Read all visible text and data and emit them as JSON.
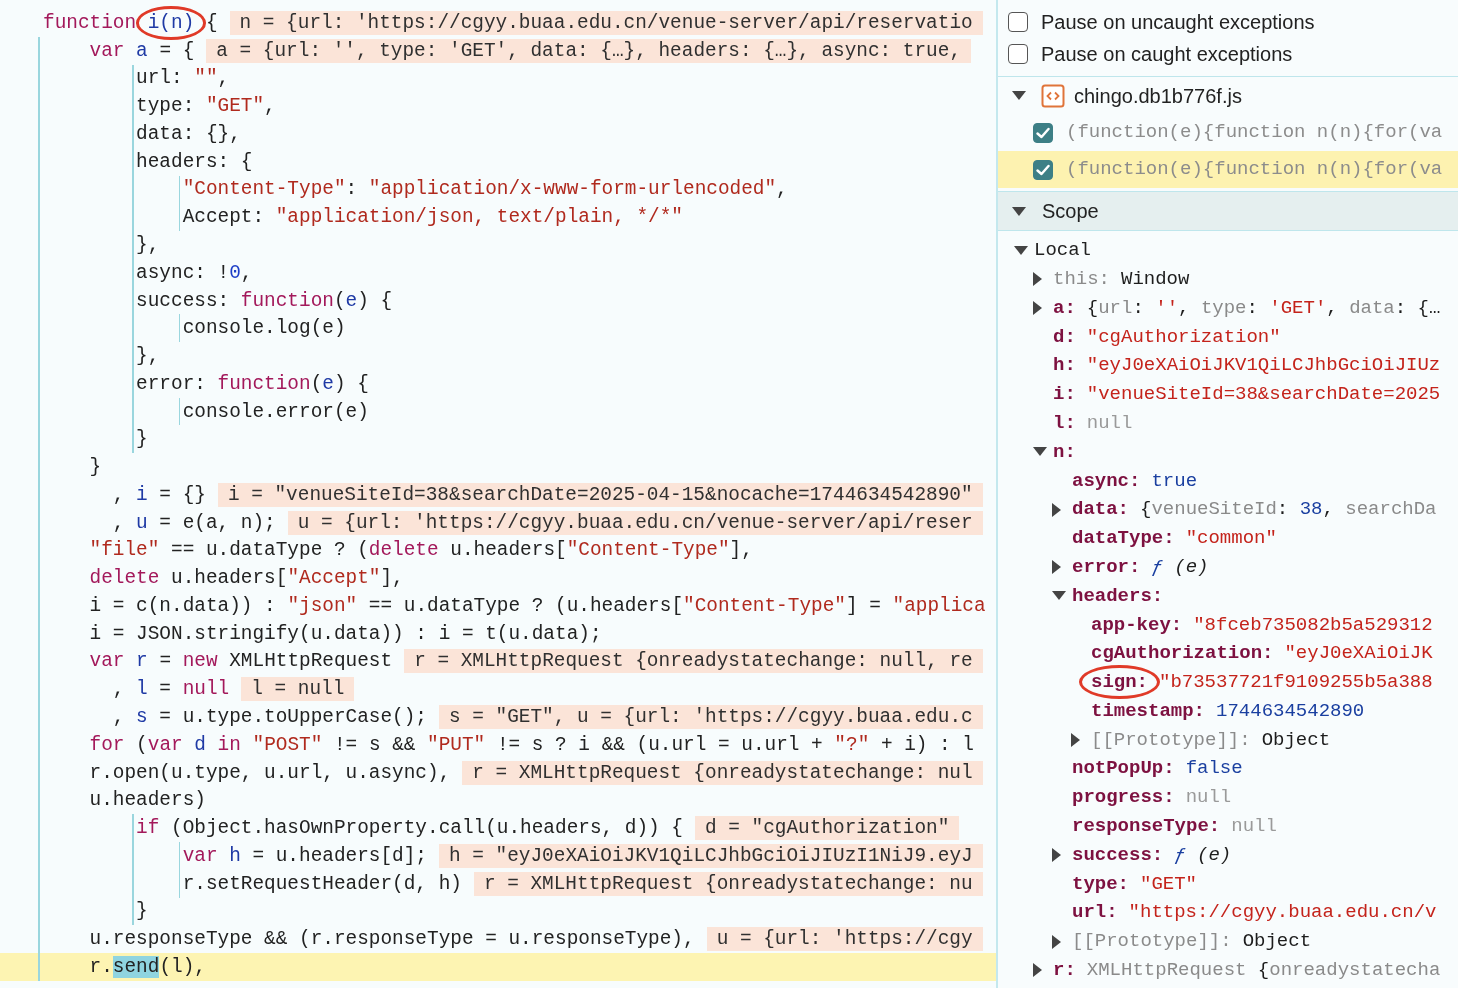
{
  "code_lines": [
    {
      "tokens": [
        {
          "kind": "kw",
          "text": "function "
        },
        {
          "kind": "circled",
          "text": "i(n)"
        },
        {
          "kind": "plain",
          "text": " {"
        }
      ],
      "inline_value": "n = {url: 'https://cgyy.buaa.edu.cn/venue-server/api/reservatio",
      "paused": false
    },
    {
      "tokens": [
        {
          "kind": "kw",
          "text": "    var"
        },
        {
          "kind": "def",
          "text": " a"
        },
        {
          "kind": "plain",
          "text": " = {"
        }
      ],
      "inline_value": "a = {url: '', type: 'GET', data: {…}, headers: {…}, async: true,",
      "paused": false
    },
    {
      "tokens": [
        {
          "kind": "plain",
          "text": "        url: "
        },
        {
          "kind": "str",
          "text": "\"\""
        },
        {
          "kind": "plain",
          "text": ","
        }
      ],
      "paused": false
    },
    {
      "tokens": [
        {
          "kind": "plain",
          "text": "        type: "
        },
        {
          "kind": "str",
          "text": "\"GET\""
        },
        {
          "kind": "plain",
          "text": ","
        }
      ],
      "paused": false
    },
    {
      "tokens": [
        {
          "kind": "plain",
          "text": "        data: {},"
        }
      ],
      "paused": false
    },
    {
      "tokens": [
        {
          "kind": "plain",
          "text": "        headers: {"
        }
      ],
      "paused": false
    },
    {
      "tokens": [
        {
          "kind": "str",
          "text": "            \"Content-Type\""
        },
        {
          "kind": "plain",
          "text": ": "
        },
        {
          "kind": "str",
          "text": "\"application/x-www-form-urlencoded\""
        },
        {
          "kind": "plain",
          "text": ","
        }
      ],
      "paused": false
    },
    {
      "tokens": [
        {
          "kind": "plain",
          "text": "            Accept: "
        },
        {
          "kind": "str",
          "text": "\"application/json, text/plain, */*\""
        }
      ],
      "paused": false
    },
    {
      "tokens": [
        {
          "kind": "plain",
          "text": "        },"
        }
      ],
      "paused": false
    },
    {
      "tokens": [
        {
          "kind": "plain",
          "text": "        async: !"
        },
        {
          "kind": "num",
          "text": "0"
        },
        {
          "kind": "plain",
          "text": ","
        }
      ],
      "paused": false
    },
    {
      "tokens": [
        {
          "kind": "plain",
          "text": "        success: "
        },
        {
          "kind": "kw",
          "text": "function"
        },
        {
          "kind": "plain",
          "text": "("
        },
        {
          "kind": "def",
          "text": "e"
        },
        {
          "kind": "plain",
          "text": ") {"
        }
      ],
      "paused": false
    },
    {
      "tokens": [
        {
          "kind": "plain",
          "text": "            console.log(e)"
        }
      ],
      "paused": false
    },
    {
      "tokens": [
        {
          "kind": "plain",
          "text": "        },"
        }
      ],
      "paused": false
    },
    {
      "tokens": [
        {
          "kind": "plain",
          "text": "        error: "
        },
        {
          "kind": "kw",
          "text": "function"
        },
        {
          "kind": "plain",
          "text": "("
        },
        {
          "kind": "def",
          "text": "e"
        },
        {
          "kind": "plain",
          "text": ") {"
        }
      ],
      "paused": false
    },
    {
      "tokens": [
        {
          "kind": "plain",
          "text": "            console.error(e)"
        }
      ],
      "paused": false
    },
    {
      "tokens": [
        {
          "kind": "plain",
          "text": "        }"
        }
      ],
      "paused": false
    },
    {
      "tokens": [
        {
          "kind": "plain",
          "text": "    }"
        }
      ],
      "paused": false
    },
    {
      "tokens": [
        {
          "kind": "plain",
          "text": "      , "
        },
        {
          "kind": "def",
          "text": "i"
        },
        {
          "kind": "plain",
          "text": " = {}"
        }
      ],
      "inline_value": "i = \"venueSiteId=38&searchDate=2025-04-15&nocache=1744634542890\"",
      "paused": false
    },
    {
      "tokens": [
        {
          "kind": "plain",
          "text": "      , "
        },
        {
          "kind": "def",
          "text": "u"
        },
        {
          "kind": "plain",
          "text": " = e(a, n);"
        }
      ],
      "inline_value": "u = {url: 'https://cgyy.buaa.edu.cn/venue-server/api/reser",
      "paused": false
    },
    {
      "tokens": [
        {
          "kind": "str",
          "text": "    \"file\""
        },
        {
          "kind": "plain",
          "text": " == u.dataType ? ("
        },
        {
          "kind": "kw",
          "text": "delete"
        },
        {
          "kind": "plain",
          "text": " u.headers["
        },
        {
          "kind": "str",
          "text": "\"Content-Type\""
        },
        {
          "kind": "plain",
          "text": "],"
        }
      ],
      "paused": false
    },
    {
      "tokens": [
        {
          "kind": "kw",
          "text": "    delete"
        },
        {
          "kind": "plain",
          "text": " u.headers["
        },
        {
          "kind": "str",
          "text": "\"Accept\""
        },
        {
          "kind": "plain",
          "text": "],"
        }
      ],
      "paused": false
    },
    {
      "tokens": [
        {
          "kind": "plain",
          "text": "    i = c(n.data)) : "
        },
        {
          "kind": "str",
          "text": "\"json\""
        },
        {
          "kind": "plain",
          "text": " == u.dataType ? (u.headers["
        },
        {
          "kind": "str",
          "text": "\"Content-Type\""
        },
        {
          "kind": "plain",
          "text": "] = "
        },
        {
          "kind": "str",
          "text": "\"applica"
        }
      ],
      "paused": false
    },
    {
      "tokens": [
        {
          "kind": "plain",
          "text": "    i = JSON.stringify(u.data)) : i = t(u.data);"
        }
      ],
      "paused": false
    },
    {
      "tokens": [
        {
          "kind": "kw",
          "text": "    var"
        },
        {
          "kind": "def",
          "text": " r"
        },
        {
          "kind": "plain",
          "text": " = "
        },
        {
          "kind": "kw",
          "text": "new"
        },
        {
          "kind": "plain",
          "text": " XMLHttpRequest"
        }
      ],
      "inline_value": "r = XMLHttpRequest {onreadystatechange: null, re",
      "paused": false
    },
    {
      "tokens": [
        {
          "kind": "plain",
          "text": "      , "
        },
        {
          "kind": "def",
          "text": "l"
        },
        {
          "kind": "plain",
          "text": " = "
        },
        {
          "kind": "kw",
          "text": "null"
        }
      ],
      "inline_value": "l = null",
      "paused": false
    },
    {
      "tokens": [
        {
          "kind": "plain",
          "text": "      , "
        },
        {
          "kind": "def",
          "text": "s"
        },
        {
          "kind": "plain",
          "text": " = u.type.toUpperCase();"
        }
      ],
      "inline_value": "s = \"GET\", u = {url: 'https://cgyy.buaa.edu.c",
      "paused": false
    },
    {
      "tokens": [
        {
          "kind": "kw",
          "text": "    for"
        },
        {
          "kind": "plain",
          "text": " ("
        },
        {
          "kind": "kw",
          "text": "var"
        },
        {
          "kind": "def",
          "text": " d"
        },
        {
          "kind": "kw",
          "text": " in"
        },
        {
          "kind": "str",
          "text": " \"POST\""
        },
        {
          "kind": "plain",
          "text": " != s && "
        },
        {
          "kind": "str",
          "text": "\"PUT\""
        },
        {
          "kind": "plain",
          "text": " != s ? i && (u.url = u.url + "
        },
        {
          "kind": "str",
          "text": "\"?\""
        },
        {
          "kind": "plain",
          "text": " + i) : l"
        }
      ],
      "paused": false
    },
    {
      "tokens": [
        {
          "kind": "plain",
          "text": "    r.open(u.type, u.url, u.async),"
        }
      ],
      "inline_value": "r = XMLHttpRequest {onreadystatechange: nul",
      "paused": false
    },
    {
      "tokens": [
        {
          "kind": "plain",
          "text": "    u.headers)"
        }
      ],
      "paused": false
    },
    {
      "tokens": [
        {
          "kind": "kw",
          "text": "        if"
        },
        {
          "kind": "plain",
          "text": " (Object.hasOwnProperty.call(u.headers, d)) {"
        }
      ],
      "inline_value": "d = \"cgAuthorization\"",
      "paused": false
    },
    {
      "tokens": [
        {
          "kind": "kw",
          "text": "            var"
        },
        {
          "kind": "def",
          "text": " h"
        },
        {
          "kind": "plain",
          "text": " = u.headers[d];"
        }
      ],
      "inline_value": "h = \"eyJ0eXAiOiJKV1QiLCJhbGciOiJIUzI1NiJ9.eyJ",
      "paused": false
    },
    {
      "tokens": [
        {
          "kind": "plain",
          "text": "            r.setRequestHeader(d, h)"
        }
      ],
      "inline_value": "r = XMLHttpRequest {onreadystatechange: nu",
      "paused": false
    },
    {
      "tokens": [
        {
          "kind": "plain",
          "text": "        }"
        }
      ],
      "paused": false
    },
    {
      "tokens": [
        {
          "kind": "plain",
          "text": "    u.responseType && (r.responseType = u.responseType),"
        }
      ],
      "inline_value": "u = {url: 'https://cgy",
      "paused": false
    },
    {
      "tokens": [
        {
          "kind": "plain",
          "text": "    r."
        },
        {
          "kind": "match",
          "text": "send"
        },
        {
          "kind": "plain",
          "text": "(l),"
        }
      ],
      "paused": true
    }
  ],
  "exception_options": [
    {
      "label": "Pause on uncaught exceptions",
      "checked": false
    },
    {
      "label": "Pause on caught exceptions",
      "checked": false
    }
  ],
  "breakpoint_file": {
    "name": "chingo.db1b776f.js",
    "expanded": true,
    "breakpoints": [
      {
        "text": "(function(e){function n(n){for(va",
        "checked": true,
        "selected": false
      },
      {
        "text": "(function(e){function n(n){for(va",
        "checked": true,
        "selected": true
      }
    ]
  },
  "scope": {
    "title": "Scope",
    "expanded": true,
    "sections": [
      {
        "name": "Local",
        "expanded": true,
        "variables": [
          {
            "name": "this:",
            "internal": true,
            "circled": false,
            "expandable": true,
            "expanded": false,
            "value": [
              {
                "kind": "plain",
                "text": "Window"
              }
            ]
          },
          {
            "name": "a:",
            "internal": false,
            "circled": false,
            "expandable": true,
            "expanded": false,
            "value": [
              {
                "kind": "plain",
                "text": "{"
              },
              {
                "kind": "dim",
                "text": "url"
              },
              {
                "kind": "plain",
                "text": ": "
              },
              {
                "kind": "str",
                "text": "''"
              },
              {
                "kind": "plain",
                "text": ", "
              },
              {
                "kind": "dim",
                "text": "type"
              },
              {
                "kind": "plain",
                "text": ": "
              },
              {
                "kind": "str",
                "text": "'GET'"
              },
              {
                "kind": "plain",
                "text": ", "
              },
              {
                "kind": "dim",
                "text": "data"
              },
              {
                "kind": "plain",
                "text": ": {…"
              }
            ]
          },
          {
            "name": "d:",
            "internal": false,
            "circled": false,
            "expandable": false,
            "value": [
              {
                "kind": "str",
                "text": "\"cgAuthorization\""
              }
            ]
          },
          {
            "name": "h:",
            "internal": false,
            "circled": false,
            "expandable": false,
            "value": [
              {
                "kind": "str",
                "text": "\"eyJ0eXAiOiJKV1QiLCJhbGciOiJIUz"
              }
            ]
          },
          {
            "name": "i:",
            "internal": false,
            "circled": false,
            "expandable": false,
            "value": [
              {
                "kind": "str",
                "text": "\"venueSiteId=38&searchDate=2025"
              }
            ]
          },
          {
            "name": "l:",
            "internal": false,
            "circled": false,
            "expandable": false,
            "value": [
              {
                "kind": "null",
                "text": "null"
              }
            ]
          },
          {
            "name": "n:",
            "internal": false,
            "circled": false,
            "expandable": true,
            "expanded": true,
            "children": [
              {
                "name": "async:",
                "internal": false,
                "circled": false,
                "expandable": false,
                "value": [
                  {
                    "kind": "lit",
                    "text": "true"
                  }
                ]
              },
              {
                "name": "data:",
                "internal": false,
                "circled": false,
                "expandable": true,
                "expanded": false,
                "value": [
                  {
                    "kind": "plain",
                    "text": "{"
                  },
                  {
                    "kind": "dim",
                    "text": "venueSiteId"
                  },
                  {
                    "kind": "plain",
                    "text": ": "
                  },
                  {
                    "kind": "lit",
                    "text": "38"
                  },
                  {
                    "kind": "plain",
                    "text": ", "
                  },
                  {
                    "kind": "dim",
                    "text": "searchDa"
                  }
                ]
              },
              {
                "name": "dataType:",
                "internal": false,
                "circled": false,
                "expandable": false,
                "value": [
                  {
                    "kind": "str",
                    "text": "\"common\""
                  }
                ]
              },
              {
                "name": "error:",
                "internal": false,
                "circled": false,
                "expandable": true,
                "expanded": false,
                "value": [
                  {
                    "kind": "fn",
                    "text": "ƒ"
                  },
                  {
                    "kind": "italic",
                    "text": " (e)"
                  }
                ]
              },
              {
                "name": "headers:",
                "internal": false,
                "circled": false,
                "expandable": true,
                "expanded": true,
                "children": [
                  {
                    "name": "app-key:",
                    "internal": false,
                    "circled": false,
                    "expandable": false,
                    "value": [
                      {
                        "kind": "str",
                        "text": "\"8fceb735082b5a529312"
                      }
                    ]
                  },
                  {
                    "name": "cgAuthorization:",
                    "internal": false,
                    "circled": false,
                    "expandable": false,
                    "value": [
                      {
                        "kind": "str",
                        "text": "\"eyJ0eXAiOiJK"
                      }
                    ]
                  },
                  {
                    "name": "sign:",
                    "internal": false,
                    "circled": true,
                    "expandable": false,
                    "value": [
                      {
                        "kind": "str",
                        "text": "\"b73537721f9109255b5a388"
                      }
                    ]
                  },
                  {
                    "name": "timestamp:",
                    "internal": false,
                    "circled": false,
                    "expandable": false,
                    "value": [
                      {
                        "kind": "lit",
                        "text": "1744634542890"
                      }
                    ]
                  },
                  {
                    "name": "[[Prototype]]:",
                    "internal": true,
                    "circled": false,
                    "expandable": true,
                    "expanded": false,
                    "value": [
                      {
                        "kind": "plain",
                        "text": "Object"
                      }
                    ]
                  }
                ]
              },
              {
                "name": "notPopUp:",
                "internal": false,
                "circled": false,
                "expandable": false,
                "value": [
                  {
                    "kind": "lit",
                    "text": "false"
                  }
                ]
              },
              {
                "name": "progress:",
                "internal": false,
                "circled": false,
                "expandable": false,
                "value": [
                  {
                    "kind": "null",
                    "text": "null"
                  }
                ]
              },
              {
                "name": "responseType:",
                "internal": false,
                "circled": false,
                "expandable": false,
                "value": [
                  {
                    "kind": "null",
                    "text": "null"
                  }
                ]
              },
              {
                "name": "success:",
                "internal": false,
                "circled": false,
                "expandable": true,
                "expanded": false,
                "value": [
                  {
                    "kind": "fn",
                    "text": "ƒ"
                  },
                  {
                    "kind": "italic",
                    "text": " (e)"
                  }
                ]
              },
              {
                "name": "type:",
                "internal": false,
                "circled": false,
                "expandable": false,
                "value": [
                  {
                    "kind": "str",
                    "text": "\"GET\""
                  }
                ]
              },
              {
                "name": "url:",
                "internal": false,
                "circled": false,
                "expandable": false,
                "value": [
                  {
                    "kind": "str",
                    "text": "\"https://cgyy.buaa.edu.cn/v"
                  }
                ]
              },
              {
                "name": "[[Prototype]]:",
                "internal": true,
                "circled": false,
                "expandable": true,
                "expanded": false,
                "value": [
                  {
                    "kind": "plain",
                    "text": "Object"
                  }
                ]
              }
            ]
          },
          {
            "name": "r:",
            "internal": false,
            "circled": false,
            "expandable": true,
            "expanded": false,
            "value": [
              {
                "kind": "dim",
                "text": "XMLHttpRequest"
              },
              {
                "kind": "plain",
                "text": " {"
              },
              {
                "kind": "dim",
                "text": "onreadystatecha"
              }
            ]
          }
        ]
      }
    ]
  }
}
